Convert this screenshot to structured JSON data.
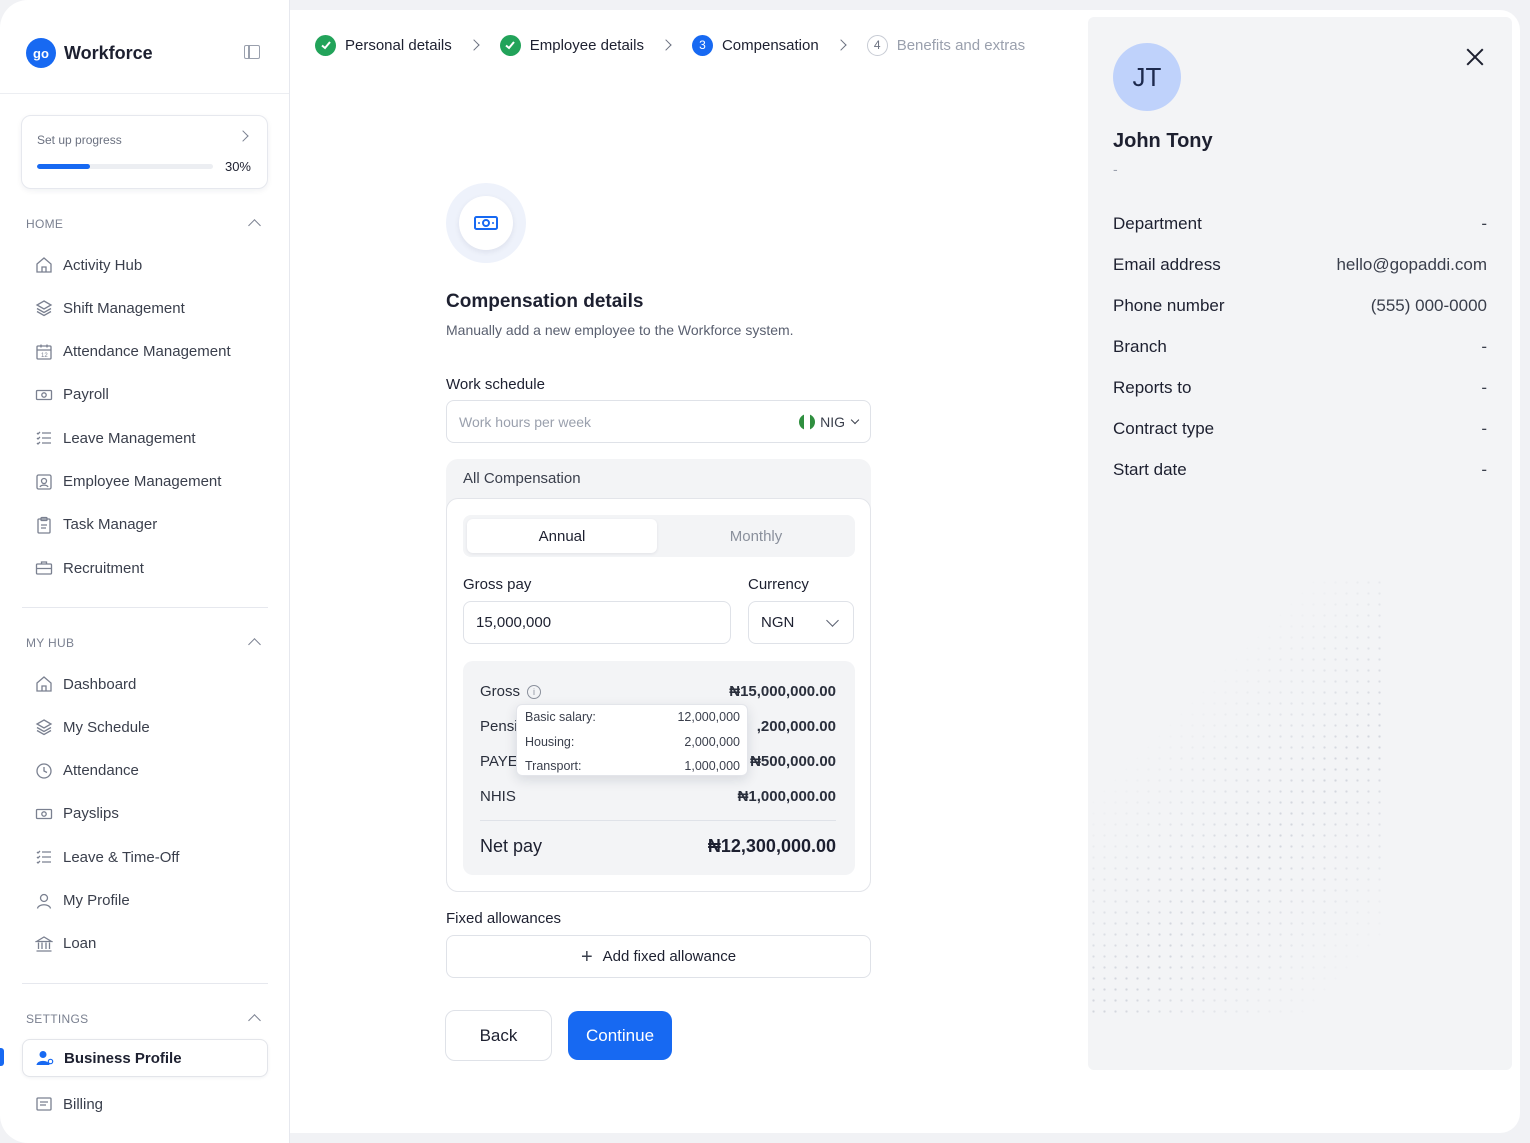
{
  "brand": {
    "name": "Workforce",
    "logo_text": "go"
  },
  "setup": {
    "label": "Set up progress",
    "percent_label": "30%",
    "percent": 30
  },
  "sections": {
    "home": "HOME",
    "my_hub": "MY HUB",
    "settings": "SETTINGS"
  },
  "home_items": [
    {
      "label": "Activity Hub",
      "icon": "home-icon"
    },
    {
      "label": "Shift Management",
      "icon": "layers-icon"
    },
    {
      "label": "Attendance Management",
      "icon": "calendar-icon"
    },
    {
      "label": "Payroll",
      "icon": "money-icon"
    },
    {
      "label": "Leave Management",
      "icon": "list-icon"
    },
    {
      "label": "Employee Management",
      "icon": "id-card-icon"
    },
    {
      "label": "Task Manager",
      "icon": "clipboard-icon"
    },
    {
      "label": "Recruitment",
      "icon": "briefcase-icon"
    }
  ],
  "hub_items": [
    {
      "label": "Dashboard",
      "icon": "home-icon"
    },
    {
      "label": "My Schedule",
      "icon": "layers-icon"
    },
    {
      "label": "Attendance",
      "icon": "clock-icon"
    },
    {
      "label": "Payslips",
      "icon": "money-icon"
    },
    {
      "label": "Leave & Time-Off",
      "icon": "list-icon"
    },
    {
      "label": "My Profile",
      "icon": "user-icon"
    },
    {
      "label": "Loan",
      "icon": "bank-icon"
    }
  ],
  "settings_items": [
    {
      "label": "Business Profile",
      "icon": "user-settings-icon",
      "active": true
    },
    {
      "label": "Billing",
      "icon": "receipt-icon"
    }
  ],
  "stepper": [
    {
      "label": "Personal details",
      "state": "done"
    },
    {
      "label": "Employee details",
      "state": "done"
    },
    {
      "label": "Compensation",
      "state": "active",
      "num": "3"
    },
    {
      "label": "Benefits and extras",
      "state": "todo",
      "num": "4"
    }
  ],
  "form": {
    "title": "Compensation details",
    "subtitle": "Manually add a new employee to the Workforce system.",
    "work_schedule_label": "Work schedule",
    "work_hours_placeholder": "Work hours per week",
    "country_code": "NIG",
    "all_comp_label": "All Compensation",
    "tab_annual": "Annual",
    "tab_monthly": "Monthly",
    "gross_pay_label": "Gross pay",
    "gross_pay_value": "15,000,000",
    "currency_label": "Currency",
    "currency_value": "NGN",
    "fixed_allowances_label": "Fixed allowances",
    "add_allowance_label": "Add fixed allowance",
    "back_label": "Back",
    "continue_label": "Continue"
  },
  "summary": {
    "gross_label": "Gross",
    "gross_value": "₦15,000,000.00",
    "pension_label": "Pensi",
    "pension_value": ",200,000.00",
    "paye_label": "PAYE",
    "paye_value": "₦500,000.00",
    "nhis_label": "NHIS",
    "nhis_value": "₦1,000,000.00",
    "net_label": "Net pay",
    "net_value": "₦12,300,000.00"
  },
  "tooltip": [
    {
      "label": "Basic salary:",
      "value": "12,000,000"
    },
    {
      "label": "Housing:",
      "value": "2,000,000"
    },
    {
      "label": "Transport:",
      "value": "1,000,000"
    }
  ],
  "profile": {
    "initials": "JT",
    "name": "John Tony",
    "subtitle": "-",
    "rows": [
      {
        "label": "Department",
        "value": "-"
      },
      {
        "label": "Email address",
        "value": "hello@gopaddi.com"
      },
      {
        "label": "Phone number",
        "value": "(555) 000-0000"
      },
      {
        "label": "Branch",
        "value": "-"
      },
      {
        "label": "Reports to",
        "value": "-"
      },
      {
        "label": "Contract type",
        "value": "-"
      },
      {
        "label": "Start date",
        "value": "-"
      }
    ]
  },
  "colors": {
    "accent": "#1769f2",
    "success": "#22a35a",
    "avatar_bg": "#bfd2fb"
  }
}
